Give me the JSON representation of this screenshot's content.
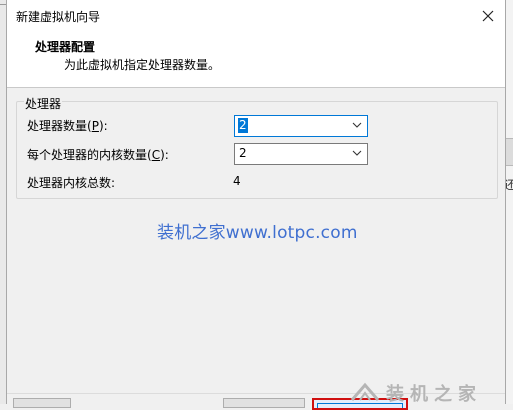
{
  "window": {
    "title": "新建虚拟机向导"
  },
  "header": {
    "title": "处理器配置",
    "subtitle": "为此虚拟机指定处理器数量。"
  },
  "group": {
    "label": "处理器",
    "processors": {
      "label_prefix": "处理器数量(",
      "mnemonic": "P",
      "label_suffix": "):",
      "value": "2"
    },
    "cores_per_processor": {
      "label_prefix": "每个处理器的内核数量(",
      "mnemonic": "C",
      "label_suffix": "):",
      "value": "2"
    },
    "total_cores": {
      "label": "处理器内核总数:",
      "value": "4"
    }
  },
  "watermark": {
    "text": "装机之家www.lotpc.com"
  },
  "background": {
    "right_glyph": "还"
  },
  "corner_logo": {
    "text": "装机之家"
  },
  "icons": [
    "close-icon",
    "chevron-down-icon",
    "logo-icon"
  ],
  "colors": {
    "accent": "#0078d7",
    "watermark": "#3f6fd0",
    "focus_border": "#d01010"
  }
}
